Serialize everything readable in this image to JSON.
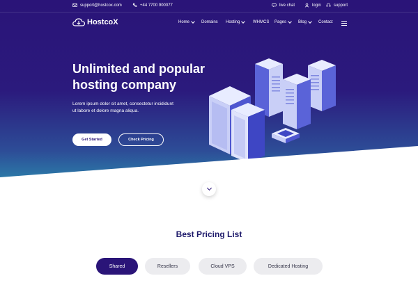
{
  "topbar": {
    "email": "support@hostcox.com",
    "phone": "+44 7700 900077",
    "live_chat": "live chat",
    "login": "login",
    "support": "support"
  },
  "brand": {
    "name": "HostcoX",
    "logo_icon": "cloud-download-icon"
  },
  "nav": {
    "items": [
      {
        "label": "Home",
        "has_dropdown": true
      },
      {
        "label": "Domains",
        "has_dropdown": false
      },
      {
        "label": "Hosting",
        "has_dropdown": true
      },
      {
        "label": "WHMCS",
        "has_dropdown": false
      },
      {
        "label": "Pages",
        "has_dropdown": true
      },
      {
        "label": "Blog",
        "has_dropdown": true
      },
      {
        "label": "Contact",
        "has_dropdown": false
      }
    ],
    "menu_icon": "hamburger-icon"
  },
  "hero": {
    "title_line1": "Unlimited and popular",
    "title_line2": "hosting company",
    "subtitle_line1": "Lorem ipsum dolor sit amet, consectetur incididunt",
    "subtitle_line2": "ut labore et dolore magna aliqua.",
    "primary_button": "Get Started",
    "secondary_button": "Check Pricing"
  },
  "pricing": {
    "title": "Best Pricing List",
    "tabs": [
      {
        "label": "Shared",
        "active": true
      },
      {
        "label": "Resellers",
        "active": false
      },
      {
        "label": "Cloud VPS",
        "active": false
      },
      {
        "label": "Dedicated Hosting",
        "active": false
      }
    ]
  },
  "colors": {
    "primary": "#2a1478",
    "gradient_bottom": "#2aa0b6",
    "heading": "#1e1a6b",
    "tab_inactive": "#ececef"
  }
}
